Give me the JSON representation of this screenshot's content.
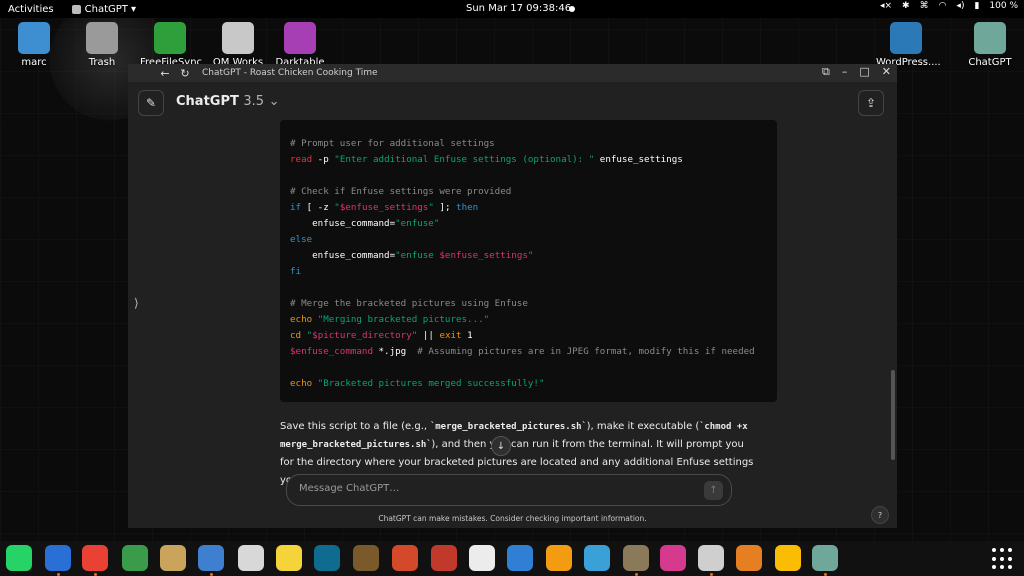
{
  "topbar": {
    "activities": "Activities",
    "app_menu": "ChatGPT ▾",
    "clock": "Sun Mar 17  09:38:46",
    "battery": "100 %"
  },
  "desktop": {
    "icons": [
      {
        "label": "marc",
        "color": "#3d8fd1"
      },
      {
        "label": "Trash",
        "color": "#9a9a9a"
      },
      {
        "label": "FreeFileSync",
        "color": "#2e9f3a"
      },
      {
        "label": "OM Works",
        "color": "#c8c8c8"
      },
      {
        "label": "Darktable",
        "color": "#a63fb3"
      },
      {
        "label": "WordPress....",
        "color": "#2c79b8"
      },
      {
        "label": "ChatGPT",
        "color": "#6fa89a"
      }
    ]
  },
  "window": {
    "title": "ChatGPT - Roast Chicken Cooking Time",
    "model_name": "ChatGPT",
    "model_version": "3.5",
    "code_lines": [
      [
        {
          "t": "# Prompt user for additional settings",
          "c": "cm"
        }
      ],
      [
        {
          "t": "read",
          "c": "fn"
        },
        {
          "t": " -p ",
          "c": ""
        },
        {
          "t": "\"Enter additional Enfuse settings (optional): \"",
          "c": "st"
        },
        {
          "t": " enfuse_settings",
          "c": ""
        }
      ],
      [
        {
          "t": "",
          "c": ""
        }
      ],
      [
        {
          "t": "# Check if Enfuse settings were provided",
          "c": "cm"
        }
      ],
      [
        {
          "t": "if",
          "c": "kw"
        },
        {
          "t": " [ -z ",
          "c": ""
        },
        {
          "t": "\"",
          "c": "st"
        },
        {
          "t": "$enfuse_settings",
          "c": "vr"
        },
        {
          "t": "\"",
          "c": "st"
        },
        {
          "t": " ]; ",
          "c": ""
        },
        {
          "t": "then",
          "c": "kw"
        }
      ],
      [
        {
          "t": "    enfuse_command=",
          "c": ""
        },
        {
          "t": "\"enfuse\"",
          "c": "st"
        }
      ],
      [
        {
          "t": "else",
          "c": "kw"
        }
      ],
      [
        {
          "t": "    enfuse_command=",
          "c": ""
        },
        {
          "t": "\"enfuse ",
          "c": "st"
        },
        {
          "t": "$enfuse_settings",
          "c": "vr"
        },
        {
          "t": "\"",
          "c": "st"
        }
      ],
      [
        {
          "t": "fi",
          "c": "kw"
        }
      ],
      [
        {
          "t": "",
          "c": ""
        }
      ],
      [
        {
          "t": "# Merge the bracketed pictures using Enfuse",
          "c": "cm"
        }
      ],
      [
        {
          "t": "echo",
          "c": "or"
        },
        {
          "t": " ",
          "c": ""
        },
        {
          "t": "\"Merging bracketed pictures...\"",
          "c": "st"
        }
      ],
      [
        {
          "t": "cd",
          "c": "or"
        },
        {
          "t": " ",
          "c": ""
        },
        {
          "t": "\"",
          "c": "st"
        },
        {
          "t": "$picture_directory",
          "c": "vr"
        },
        {
          "t": "\"",
          "c": "st"
        },
        {
          "t": " || ",
          "c": ""
        },
        {
          "t": "exit",
          "c": "or"
        },
        {
          "t": " 1",
          "c": ""
        }
      ],
      [
        {
          "t": "$enfuse_command",
          "c": "vr"
        },
        {
          "t": " *.jpg  ",
          "c": ""
        },
        {
          "t": "# Assuming pictures are in JPEG format, modify this if needed",
          "c": "cm"
        }
      ],
      [
        {
          "t": "",
          "c": ""
        }
      ],
      [
        {
          "t": "echo",
          "c": "or"
        },
        {
          "t": " ",
          "c": ""
        },
        {
          "t": "\"Bracketed pictures merged successfully!\"",
          "c": "st"
        }
      ]
    ],
    "prose": {
      "p1": "Save this script to a file (e.g., `",
      "code1": "merge_bracketed_pictures.sh",
      "p2": "`), make it executable (`",
      "code2": "chmod +x merge_bracketed_pictures.sh",
      "p3": "`), and then you can run it from the terminal. It will prompt you for the directory where your bracketed pictures are located and any additional Enfuse settings you want to apply."
    },
    "input_placeholder": "Message ChatGPT…",
    "disclaimer": "ChatGPT can make mistakes. Consider checking important information.",
    "help": "?"
  },
  "dock": {
    "apps": [
      {
        "name": "whatsapp",
        "color": "#25d366",
        "running": false
      },
      {
        "name": "thunderbird",
        "color": "#2a6fd6",
        "running": true
      },
      {
        "name": "chrome",
        "color": "#e94235",
        "running": true
      },
      {
        "name": "recycle",
        "color": "#3a9b4b",
        "running": false
      },
      {
        "name": "archive",
        "color": "#c9a45a",
        "running": false
      },
      {
        "name": "text-editor",
        "color": "#3f7fd0",
        "running": true
      },
      {
        "name": "document-viewer",
        "color": "#d8d8d8",
        "running": false
      },
      {
        "name": "notes",
        "color": "#f5d43a",
        "running": false
      },
      {
        "name": "reader",
        "color": "#0f6b8f",
        "running": false
      },
      {
        "name": "globe",
        "color": "#7a5a2a",
        "running": false
      },
      {
        "name": "office",
        "color": "#d5492b",
        "running": false
      },
      {
        "name": "camera",
        "color": "#c0392b",
        "running": false
      },
      {
        "name": "obs",
        "color": "#ececec",
        "running": false
      },
      {
        "name": "pcloud",
        "color": "#2f7fd4",
        "running": false
      },
      {
        "name": "media",
        "color": "#f39c12",
        "running": false
      },
      {
        "name": "gallery",
        "color": "#3aa0d8",
        "running": false
      },
      {
        "name": "gimp",
        "color": "#8a7a5a",
        "running": true
      },
      {
        "name": "color-picker",
        "color": "#d63a8f",
        "running": false
      },
      {
        "name": "photos",
        "color": "#cfcfcf",
        "running": true
      },
      {
        "name": "files",
        "color": "#e67e22",
        "running": false
      },
      {
        "name": "google-photos",
        "color": "#fbbc04",
        "running": false
      },
      {
        "name": "chatgpt",
        "color": "#6fa89a",
        "running": true
      }
    ]
  }
}
